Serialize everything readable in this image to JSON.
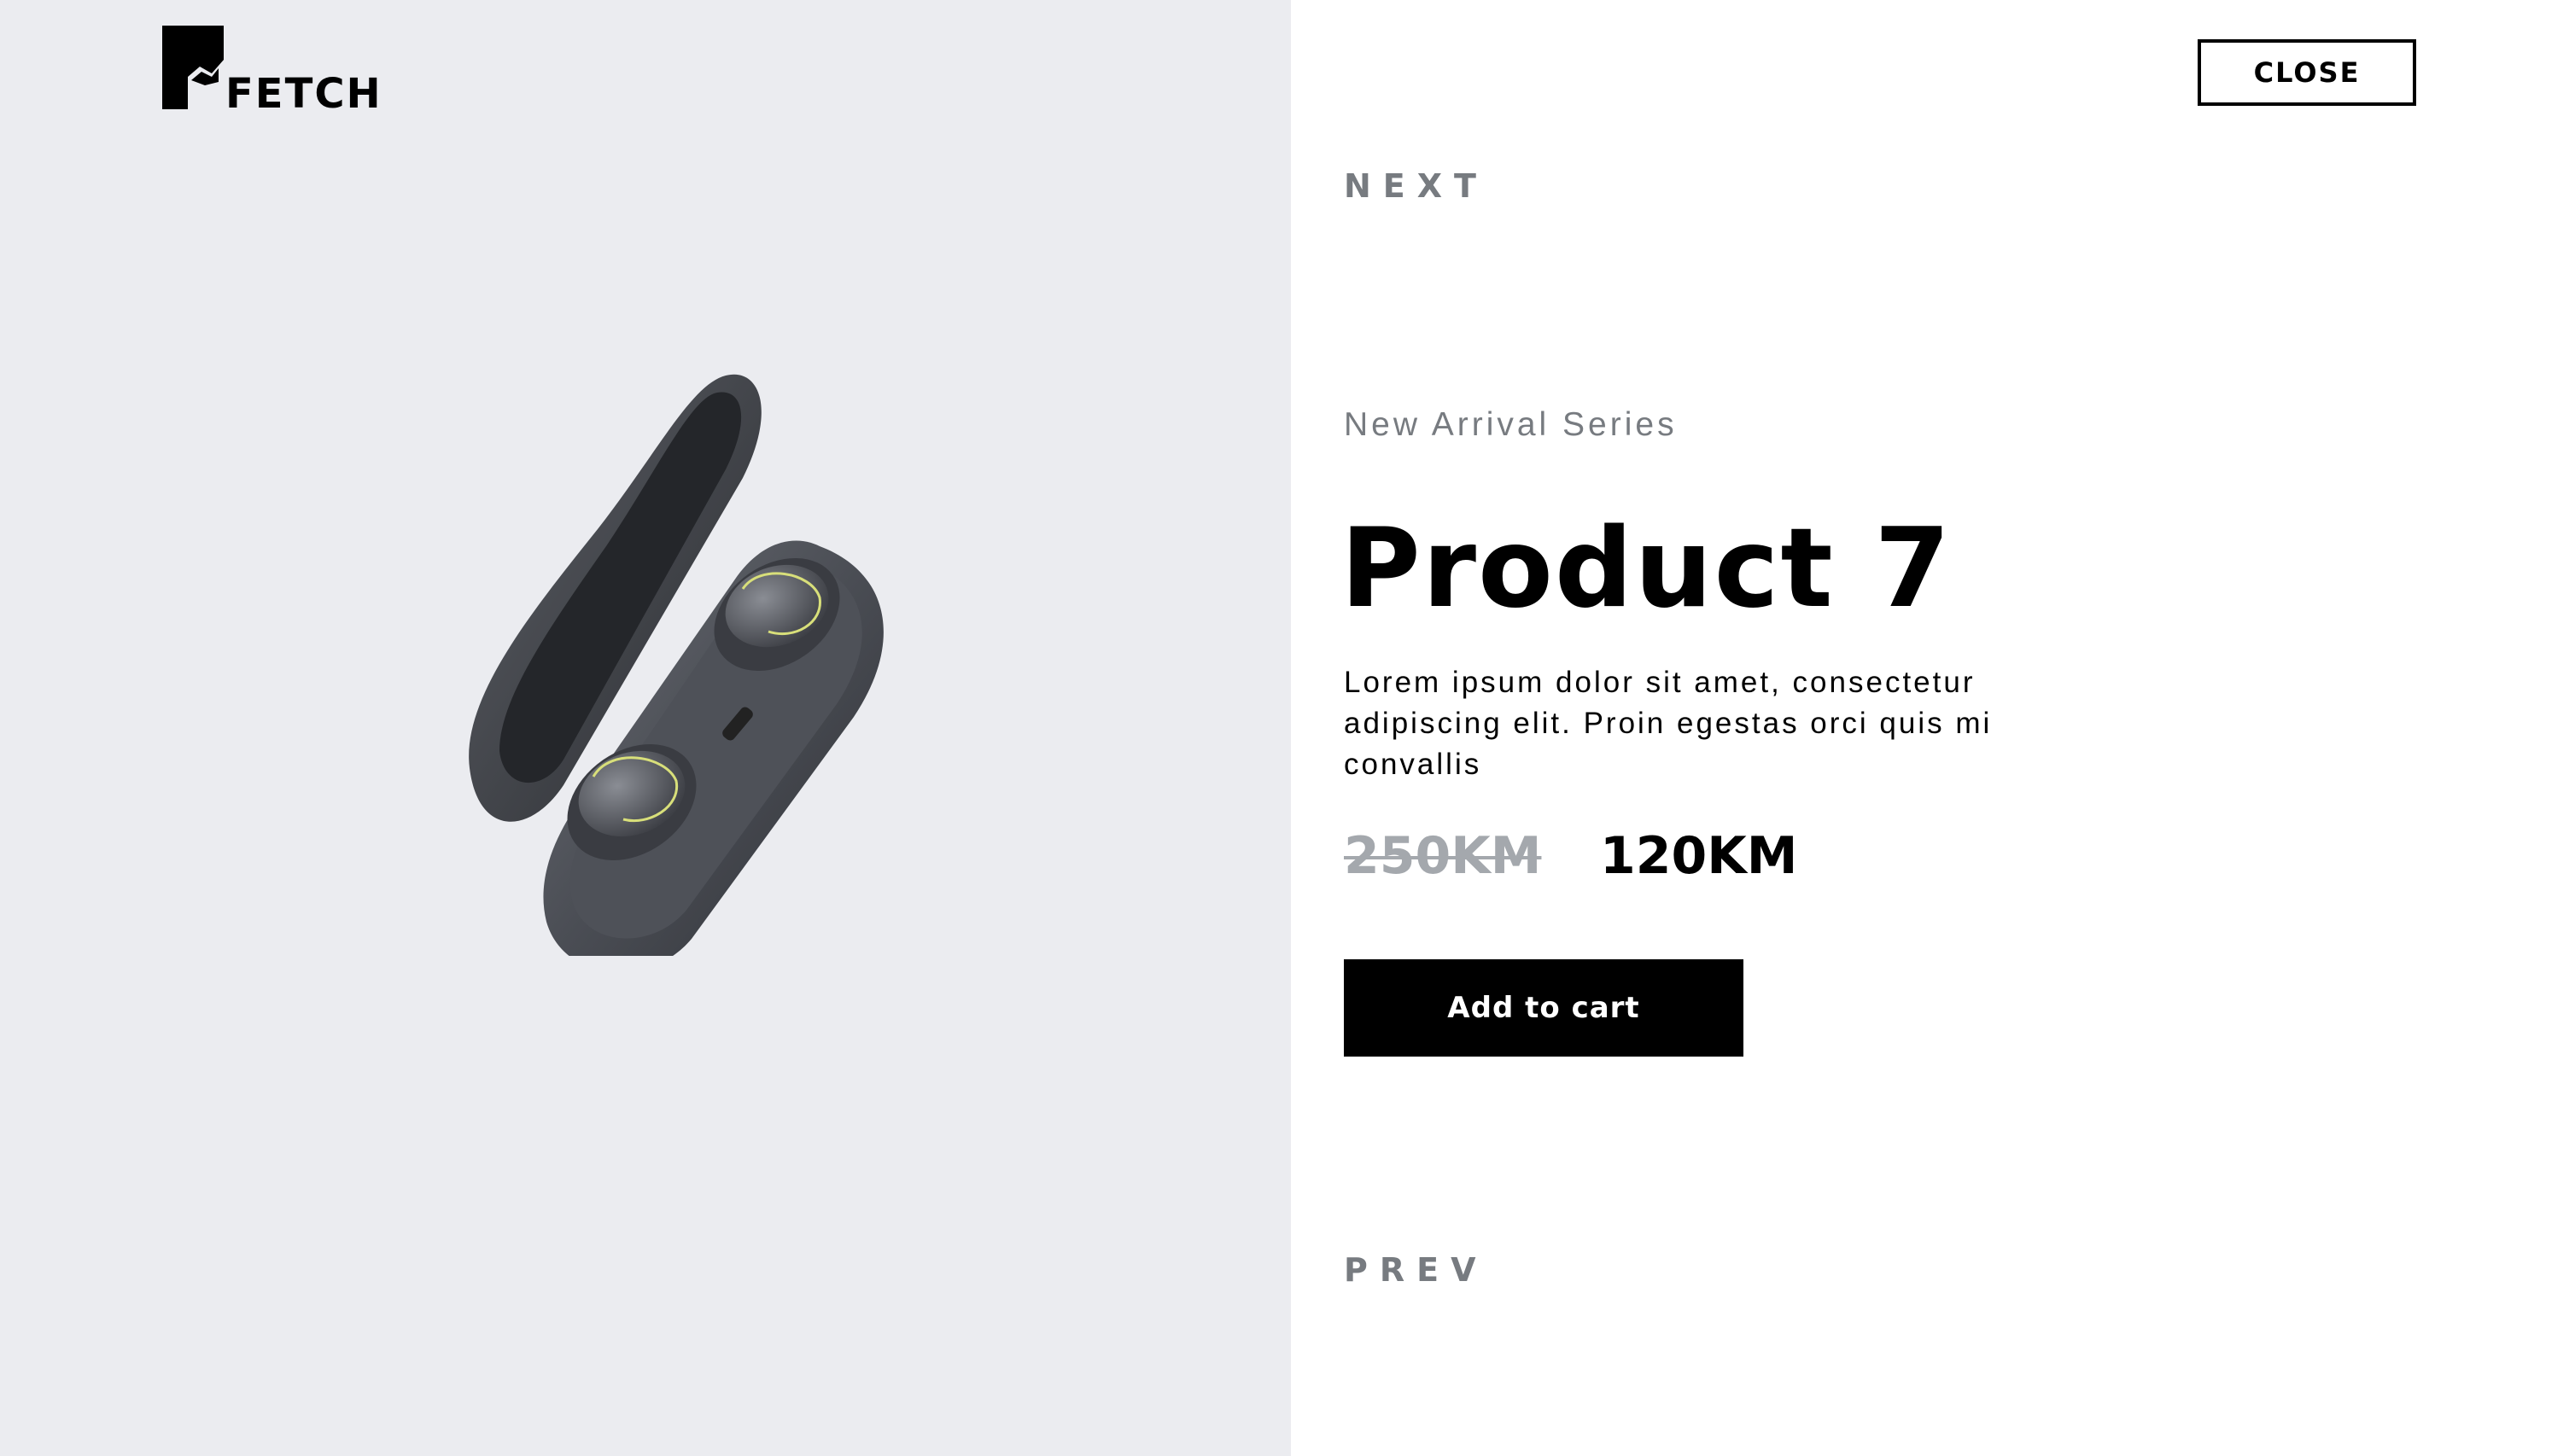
{
  "brand": {
    "logo_text": "FETCH"
  },
  "header": {
    "close_label": "CLOSE"
  },
  "navigation": {
    "next_label": "NEXT",
    "prev_label": "PREV"
  },
  "product": {
    "series": "New Arrival Series",
    "name": "Product 7",
    "description": "Lorem ipsum dolor sit amet, consectetur adipiscing elit. Proin egestas orci quis mi convallis",
    "old_price": "250KM",
    "new_price": "120KM",
    "add_to_cart_label": "Add to cart",
    "image_icon": "earbuds-case-image"
  },
  "colors": {
    "left_panel_bg": "#ebecf0",
    "right_panel_bg": "#ffffff",
    "text_primary": "#000000",
    "text_muted": "#777b80",
    "old_price": "#a4a8ad",
    "button_bg": "#000000",
    "button_text": "#ffffff"
  }
}
